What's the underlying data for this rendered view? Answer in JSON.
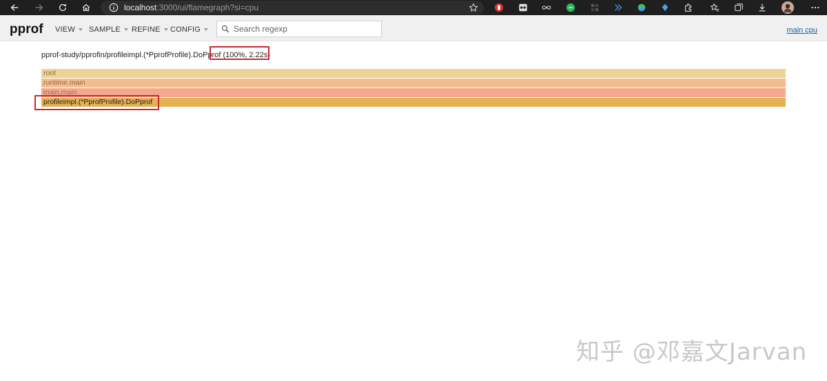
{
  "browser": {
    "url_host": "localhost",
    "url_path": ":3000/ui/flamegraph?si=cpu"
  },
  "header": {
    "logo": "pprof",
    "menus": [
      "VIEW",
      "SAMPLE",
      "REFINE",
      "CONFIG"
    ],
    "search_placeholder": "Search regexp",
    "profile_link": "main cpu"
  },
  "flamegraph": {
    "details_name": "pprof-study/pprofin/profileimpl.(*PprofProfile).DoPprof",
    "details_stats": "(100%, 2.22s)",
    "frames": [
      {
        "label": "root",
        "color": "#ecd398",
        "text_color": "#8a7244"
      },
      {
        "label": "runtime.main",
        "color": "#f2bd8f",
        "text_color": "#9a6a40"
      },
      {
        "label": "main.main",
        "color": "#f4a98e",
        "text_color": "#a86a55"
      },
      {
        "label": "profileimpl.(*PprofProfile).DoPprof",
        "color": "#e4b255",
        "text_color": "#1a1a1a"
      }
    ]
  },
  "colors": {
    "highlight": "#c8282e",
    "link": "#1a5ea8"
  }
}
